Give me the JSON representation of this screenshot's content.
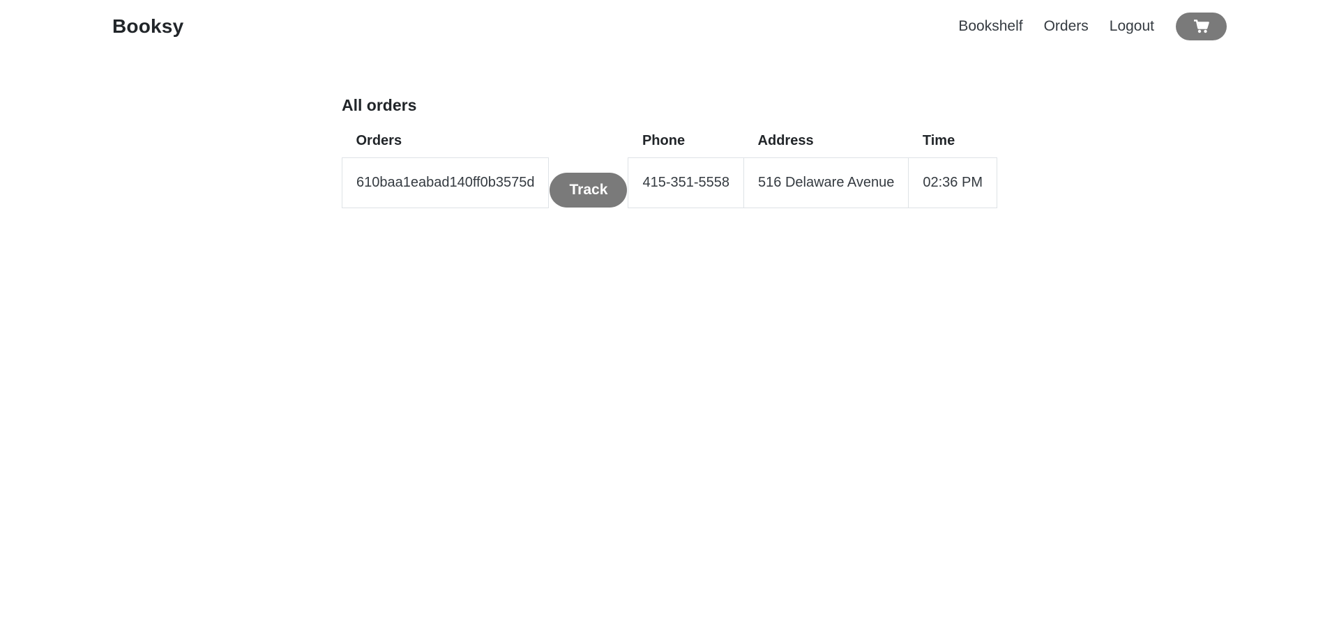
{
  "header": {
    "brand": "Booksy",
    "nav": {
      "bookshelf": "Bookshelf",
      "orders": "Orders",
      "logout": "Logout"
    },
    "cart_icon": "shopping-cart-icon"
  },
  "main": {
    "title": "All orders",
    "table": {
      "columns": [
        "Orders",
        "",
        "Phone",
        "Address",
        "Time"
      ],
      "rows": [
        {
          "order_id": "610baa1eabad140ff0b3575d",
          "action_label": "Track",
          "phone": "415-351-5558",
          "address": "516 Delaware Avenue",
          "time": "02:36 PM"
        }
      ]
    }
  },
  "colors": {
    "button_bg": "#7a7a7a",
    "button_text": "#ffffff",
    "border": "#dee2e6"
  }
}
